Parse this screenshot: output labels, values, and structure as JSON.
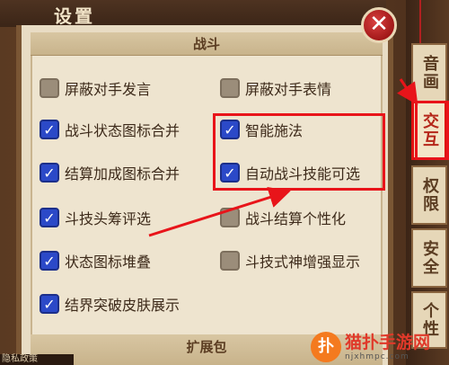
{
  "header": {
    "title": "设置",
    "close_icon_glyph": "✕"
  },
  "section": {
    "title": "战斗"
  },
  "options": [
    {
      "label": "屏蔽对手发言",
      "checked": false
    },
    {
      "label": "屏蔽对手表情",
      "checked": false
    },
    {
      "label": "战斗状态图标合并",
      "checked": true
    },
    {
      "label": "智能施法",
      "checked": true
    },
    {
      "label": "结算加成图标合并",
      "checked": true
    },
    {
      "label": "自动战斗技能可选",
      "checked": true
    },
    {
      "label": "斗技头筹评选",
      "checked": true
    },
    {
      "label": "战斗结算个性化",
      "checked": false
    },
    {
      "label": "状态图标堆叠",
      "checked": true
    },
    {
      "label": "斗技式神增强显示",
      "checked": false
    },
    {
      "label": "结界突破皮肤展示",
      "checked": true
    }
  ],
  "footer": {
    "section_title": "扩展包",
    "partial_text": "隐私政策"
  },
  "side_tabs": [
    {
      "label": "音画",
      "active": false
    },
    {
      "label": "交互",
      "active": true
    },
    {
      "label": "权限",
      "active": false
    },
    {
      "label": "安全",
      "active": false
    },
    {
      "label": "个性",
      "active": false
    }
  ],
  "watermark": {
    "logo_glyph": "扑",
    "name": "猫扑手游网",
    "domain": "njxhmpc.com"
  },
  "colors": {
    "highlight": "#e8141a",
    "checkbox_on": "#2b49c8",
    "close_button": "#c21f1f"
  }
}
